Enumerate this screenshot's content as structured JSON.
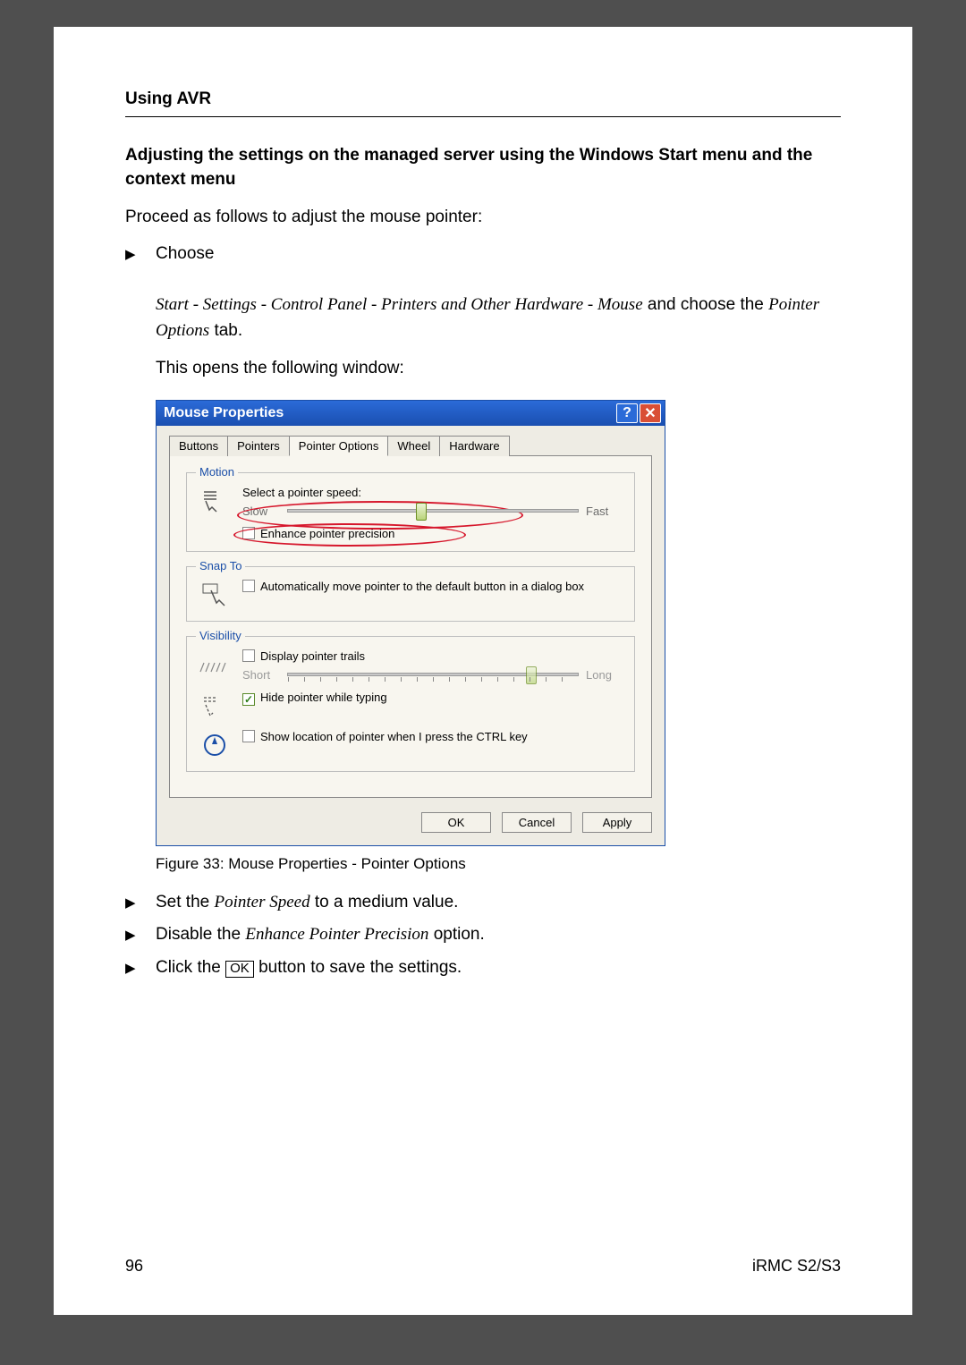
{
  "header": {
    "section": "Using AVR"
  },
  "subheading": "Adjusting the settings on the managed server using the Windows Start menu and the context menu",
  "intro": "Proceed as follows to adjust the mouse pointer:",
  "steps_top": {
    "choose": "Choose",
    "nav_path": "Start - Settings - Control Panel -  Printers and Other Hardware - Mouse",
    "nav_suffix": " and choose the ",
    "pointer_options": "Pointer Options",
    "tab_word": " tab.",
    "opens": "This opens the following window:"
  },
  "dialog": {
    "title": "Mouse Properties",
    "tabs": [
      "Buttons",
      "Pointers",
      "Pointer Options",
      "Wheel",
      "Hardware"
    ],
    "active_tab_index": 2,
    "motion": {
      "legend": "Motion",
      "select_label": "Select a pointer speed:",
      "slow": "Slow",
      "fast": "Fast",
      "enhance": "Enhance pointer precision",
      "enhance_checked": false,
      "speed_thumb_pct": 44
    },
    "snap": {
      "legend": "Snap To",
      "text": "Automatically move pointer to the default button in a dialog box",
      "checked": false
    },
    "visibility": {
      "legend": "Visibility",
      "trails": "Display pointer trails",
      "trails_checked": false,
      "short": "Short",
      "long": "Long",
      "trails_thumb_pct": 82,
      "hide": "Hide pointer while typing",
      "hide_checked": true,
      "ctrl": "Show location of pointer when I press the CTRL key",
      "ctrl_checked": false
    },
    "buttons": {
      "ok": "OK",
      "cancel": "Cancel",
      "apply": "Apply"
    }
  },
  "figure_caption": "Figure 33: Mouse Properties - Pointer Options",
  "steps_bottom": {
    "s1_pre": "Set the ",
    "s1_em": "Pointer Speed",
    "s1_post": " to a medium value.",
    "s2_pre": "Disable the ",
    "s2_em": "Enhance Pointer Precision",
    "s2_post": " option.",
    "s3_pre": "Click the ",
    "s3_ok": "OK",
    "s3_post": " button to save the settings."
  },
  "footer": {
    "page": "96",
    "doc": "iRMC S2/S3"
  }
}
